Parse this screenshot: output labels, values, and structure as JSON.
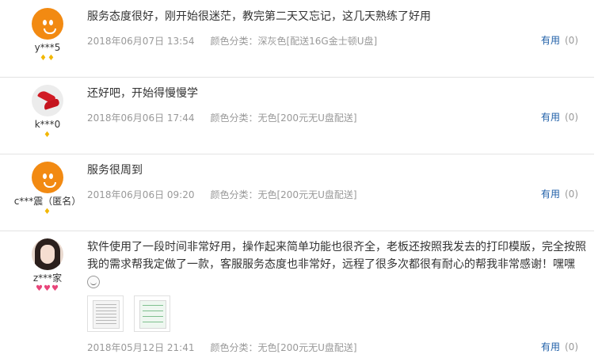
{
  "reviews": [
    {
      "user": "y***5",
      "badge": "♦♦",
      "text": "服务态度很好，刚开始很迷茫，教完第二天又忘记，这几天熟练了好用",
      "date": "2018年06月07日 13:54",
      "color": "颜色分类：深灰色[配送16G金士顿U盘]",
      "useful_label": "有用",
      "useful_count": "(0)",
      "avatar_icon": "orange-mascot-avatar-icon"
    },
    {
      "user": "k***0",
      "badge": "♦",
      "text": "还好吧，开始得慢慢学",
      "date": "2018年06月06日 17:44",
      "color": "颜色分类：无色[200元无U盘配送]",
      "useful_label": "有用",
      "useful_count": "(0)",
      "avatar_icon": "red-shoes-avatar-icon"
    },
    {
      "user": "c***震（匿名）",
      "badge": "♦",
      "text": "服务很周到",
      "date": "2018年06月06日 09:20",
      "color": "颜色分类：无色[200元无U盘配送]",
      "useful_label": "有用",
      "useful_count": "(0)",
      "avatar_icon": "orange-mascot-avatar-icon"
    },
    {
      "user": "z***家",
      "badge": "♥♥♥",
      "text": "软件使用了一段时间非常好用，操作起来简单功能也很齐全，老板还按照我发去的打印模版，完全按照我的需求帮我定做了一款，客服服务态度也非常好，远程了很多次都很有耐心的帮我非常感谢！嘿嘿",
      "date": "2018年05月12日 21:41",
      "color": "颜色分类：无色[200元无U盘配送]",
      "useful_label": "有用",
      "useful_count": "(0)",
      "avatar_icon": "user-photo-avatar-icon",
      "emoji_icon": "smile-emoji-icon",
      "images": [
        "print-template-thumbnail",
        "software-screenshot-thumbnail"
      ]
    }
  ]
}
